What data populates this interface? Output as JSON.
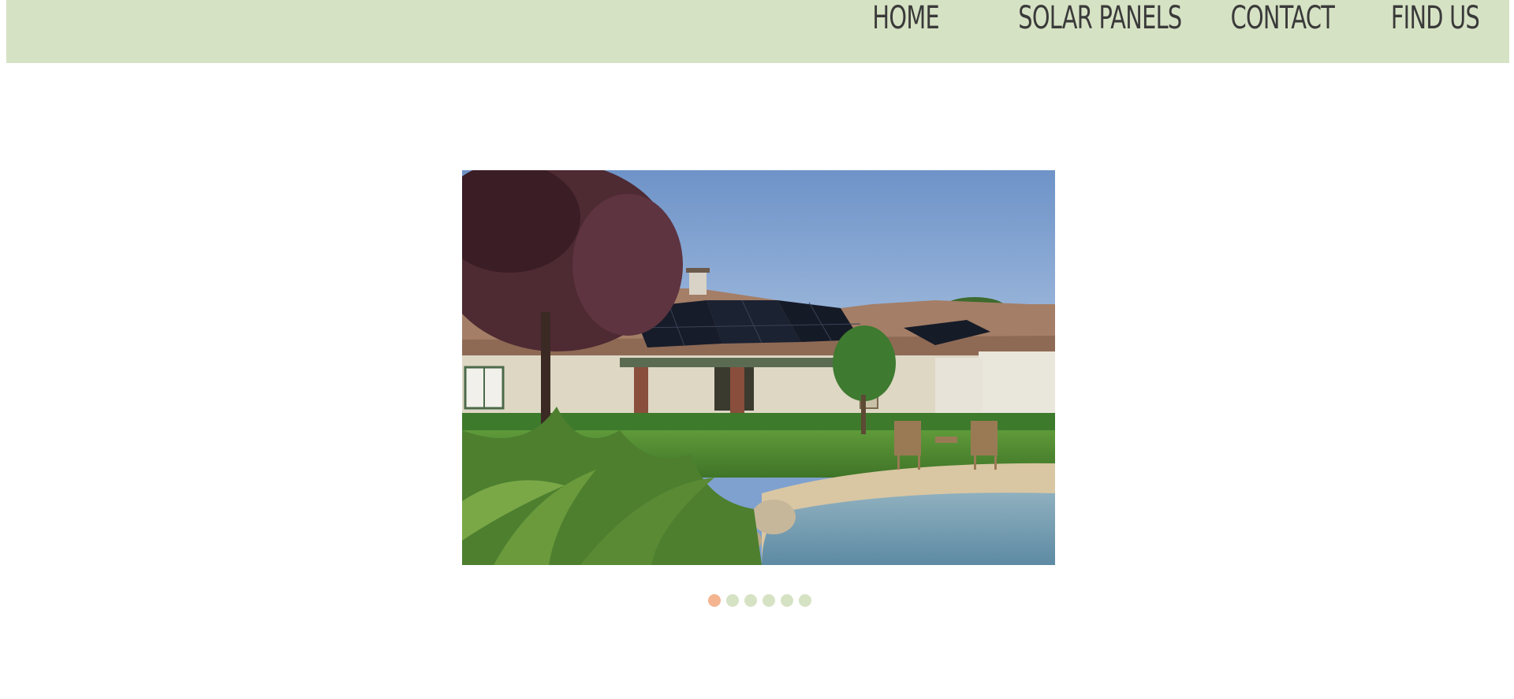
{
  "nav": {
    "items": [
      {
        "label": "HOME"
      },
      {
        "label": "SOLAR PANELS"
      },
      {
        "label": "CONTACT"
      },
      {
        "label": "FIND US"
      }
    ]
  },
  "slider": {
    "image_subject": "house with rooftop solar panels beside a garden pool",
    "slide_count": 6,
    "active_slide": 1
  },
  "colors": {
    "header_bg": "#d6e2c4",
    "nav_text": "#3a3a3a",
    "dot_inactive": "#d6e2c4",
    "dot_active": "#f3b48f"
  }
}
